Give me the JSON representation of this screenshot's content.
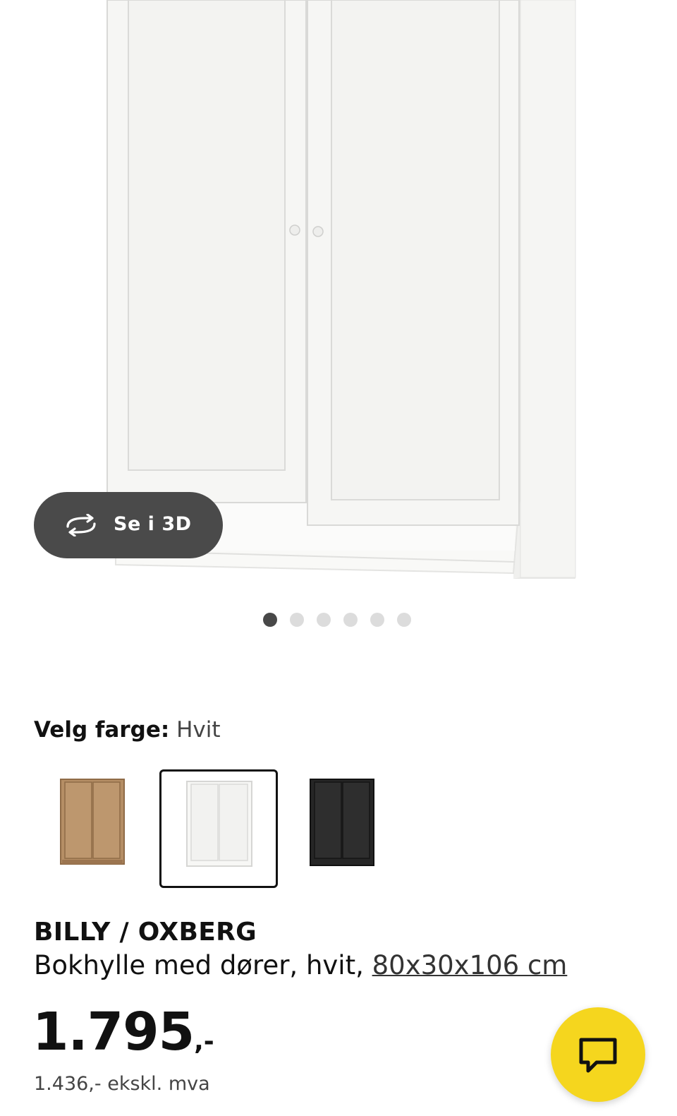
{
  "hero": {
    "view_3d_label": "Se i 3D",
    "view_3d_icon": "rotate-3d-icon",
    "image_count": 6,
    "active_image_index": 0
  },
  "color_picker": {
    "label": "Velg farge:",
    "selected_value": "Hvit",
    "options": [
      {
        "name": "oak-effect",
        "color": "#b58e65"
      },
      {
        "name": "white",
        "color": "#f4f4f2"
      },
      {
        "name": "black-brown",
        "color": "#2a2a2a"
      }
    ],
    "selected_index": 1
  },
  "product": {
    "title": "BILLY / OXBERG",
    "description": "Bokhylle med dører, hvit, ",
    "dimensions_link": "80x30x106 cm",
    "price_main": "1.795",
    "price_suffix": ",-",
    "price_ex_vat": "1.436,- ekskl. mva"
  },
  "chat": {
    "icon": "chat-icon",
    "color": "#f5d61e"
  }
}
